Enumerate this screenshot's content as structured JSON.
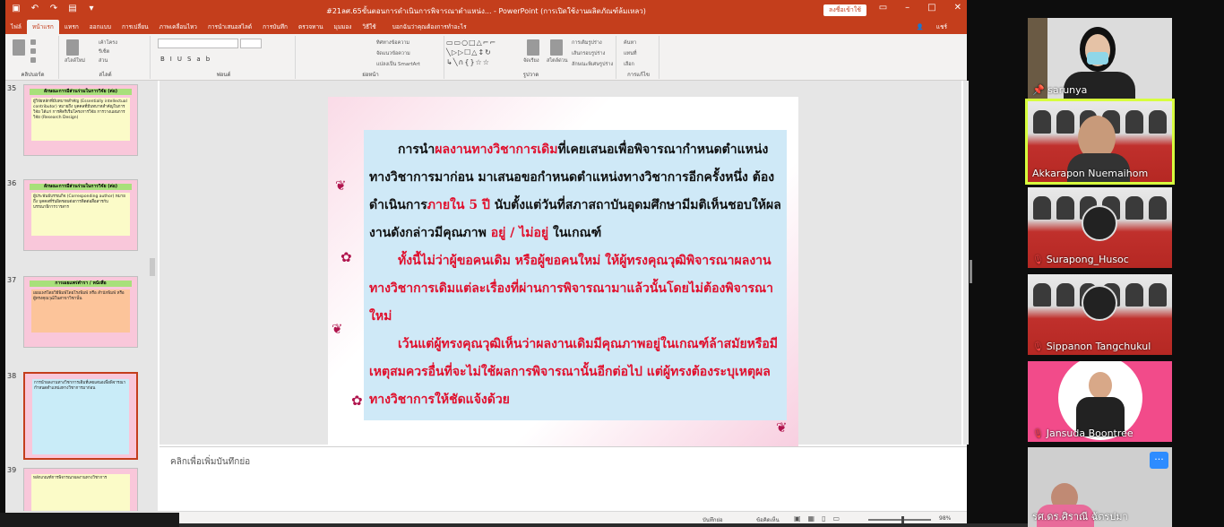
{
  "app": {
    "doc_title": "#21ลศ.65ขั้นตอนการดำเนินการพิจารณาตำแหน่ง... - PowerPoint (การเปิดใช้งานผลิตภัณฑ์ล้มเหลว)",
    "sign_in": "ลงชื่อเข้าใช้",
    "share": "แชร์"
  },
  "ribbon_tabs": [
    "ไฟล์",
    "หน้าแรก",
    "แทรก",
    "ออกแบบ",
    "การเปลี่ยน",
    "ภาพเคลื่อนไหว",
    "การนำเสนอสไลด์",
    "การบันทึก",
    "ตรวจทาน",
    "มุมมอง",
    "วิธีใช้",
    "บอกฉันว่าคุณต้องการทำอะไร"
  ],
  "ribbon_groups": {
    "clipboard": "คลิปบอร์ด",
    "slides": "สไลด์",
    "new_slide": "สไลด์ใหม่",
    "layout": "เค้าโครง",
    "reset": "รีเซ็ต",
    "section": "ส่วน",
    "font": "ฟอนต์",
    "paragraph": "ย่อหน้า",
    "text_direction": "ทิศทางข้อความ",
    "align_text": "จัดแนวข้อความ",
    "smartart": "แปลงเป็น SmartArt",
    "drawing": "รูปวาด",
    "arrange": "จัดเรียง",
    "quick_styles": "สไตล์ด่วน",
    "shape_fill": "การเติมรูปร่าง",
    "shape_outline": "เส้นกรอบรูปร่าง",
    "shape_effects": "ลักษณะพิเศษรูปร่าง",
    "editing": "การแก้ไข",
    "find": "ค้นหา",
    "replace": "แทนที่",
    "select": "เลือก"
  },
  "thumbnails": [
    {
      "num": "35",
      "title": "ลักษณะการมีส่วนร่วมในการวิจัย (ต่อ)",
      "body": "ผู้วิจัยหลักที่มีบทบาทสำคัญ (Essentially intellectual contributor) หมายถึง บุคคลที่มีบทบาทสำคัญในการวิจัย ได้แก่ การคิดริเริ่มโครงการวิจัย การวางแผนการวิจัย (Research Design)"
    },
    {
      "num": "36",
      "title": "ลักษณะการมีส่วนร่วมในการวิจัย (ต่อ)",
      "body": "ผู้ประพันธ์บรรณกิจ (Corresponding author) หมายถึง บุคคลที่รับผิดชอบต่อการติดต่อสื่อสารกับบรรณาธิการวารสาร"
    },
    {
      "num": "37",
      "title": "การเผยแพร่ตำรา / หนังสือ",
      "body": "เผยแพร่โดยวิธีพิมพ์โดยโรงพิมพ์ หรือ สำนักพิมพ์ หรือผู้ทรงคุณวุฒิในสาขาวิชานั้น"
    },
    {
      "num": "38",
      "title": "",
      "body": "การนำผลงานทางวิชาการเดิมที่เคยเสนอเพื่อพิจารณากำหนดตำแหน่งทางวิชาการมาก่อน"
    },
    {
      "num": "39",
      "title": "",
      "body": "หลักเกณฑ์การพิจารณาผลงานทางวิชาการ"
    }
  ],
  "slide": {
    "p1_a": "การนำ",
    "p1_red": "ผลงานทางวิชาการเดิม",
    "p1_b": "ที่เคยเสนอเพื่อพิจารณากำหนดตำแหน่งทางวิชาการมาก่อน มาเสนอขอกำหนดตำแหน่งทางวิชาการอีกครั้งหนึ่ง ต้องดำเนินการ",
    "p1_red2": "ภายใน 5 ปี",
    "p1_c": " นับตั้งแต่วันที่สภาสถาบันอุดมศึกษามีมติเห็นชอบให้ผลงานดังกล่าวมีคุณภาพ ",
    "p1_red3": "อยู่ / ไม่อยู่",
    "p1_d": " ในเกณฑ์",
    "p2": "ทั้งนี้ไม่ว่าผู้ขอคนเดิม หรือผู้ขอคนใหม่ ให้ผู้ทรงคุณวุฒิพิจารณาผลงานทางวิชาการเดิมแต่ละเรื่องที่ผ่านการพิจารณามาแล้วนั้นโดยไม่ต้องพิจารณาใหม่",
    "p3": "เว้นแต่ผู้ทรงคุณวุฒิเห็นว่าผลงานเดิมมีคุณภาพอยู่ในเกณฑ์ล้าสมัยหรือมีเหตุสมควรอื่นที่จะไม่ใช้ผลการพิจารณานั้นอีกต่อไป แต่ผู้ทรงต้องระบุเหตุผลทางวิชาการให้ชัดแจ้งด้วย"
  },
  "notes_placeholder": "คลิกเพื่อเพิ่มบันทึกย่อ",
  "status": {
    "notes": "บันทึกย่อ",
    "comments": "ข้อคิดเห็น",
    "zoom": "98%"
  },
  "participants": [
    {
      "name": "sarunya",
      "muted": false,
      "active": false
    },
    {
      "name": "Akkarapon Nuemaihom",
      "muted": false,
      "active": true
    },
    {
      "name": "Surapong_Husoc",
      "muted": true,
      "active": false
    },
    {
      "name": "Sippanon Tangchukul",
      "muted": true,
      "active": false
    },
    {
      "name": "Jansuda Boontree",
      "muted": true,
      "active": false
    },
    {
      "name": "รศ.ดร.ศิราณี ฉัตรปมา",
      "muted": false,
      "active": false
    }
  ],
  "colors": {
    "ppt_accent": "#c43e1c",
    "slide_text_red": "#e0102d",
    "textbox_bg": "#cfe9f7",
    "active_speaker": "#d7ff3d",
    "zoom_blue": "#2d8cff"
  }
}
